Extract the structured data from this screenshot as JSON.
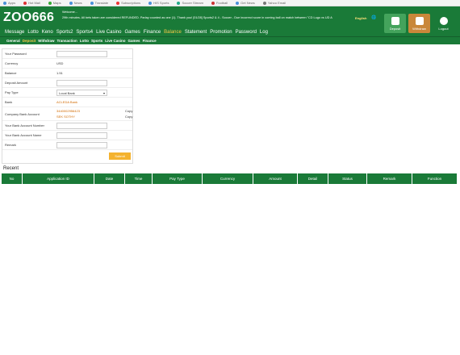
{
  "bookmarks": [
    "Apps",
    "Hot Mail",
    "Maps",
    "News",
    "Translate",
    "Subscriptions",
    "HIS Sports",
    "Soccer Stream",
    "Football",
    "Get News",
    "Yahoo Email"
  ],
  "header": {
    "logo": "ZOO666",
    "announcement_line1": "Welcome...",
    "announcement_line2": "29th minutes. All bets taken are considered REFUNDED. Parlay counted as one (1). Thank you!   [01/28] Sports2 & 4 - Soccer - Due incorrect score in coming ball on match between \"CD Lugo vs UD A",
    "language": "English",
    "language_icon": "globe-icon",
    "deposit_label": "Deposit",
    "withdraw_label": "Withdraw",
    "logout_label": "Logout"
  },
  "main_nav": [
    "Message",
    "Lotto",
    "Keno",
    "Sports2",
    "Sports4",
    "Live Casino",
    "Games",
    "Finance",
    "Balance",
    "Statement",
    "Promotion",
    "Password",
    "Log"
  ],
  "main_nav_active": "Balance",
  "sub_nav": [
    "General",
    "Deposit",
    "Withdraw",
    "Transaction",
    "Lotto",
    "Sports",
    "Live Casino",
    "Games",
    "Finance"
  ],
  "sub_nav_active": "Deposit",
  "form": {
    "your_password_label": "Your Password",
    "currency_label": "Currency",
    "currency_value": "USD",
    "balance_label": "Balance",
    "balance_value": "1.51",
    "deposit_amount_label": "Deposit Amount",
    "pay_type_label": "Pay Type",
    "pay_type_value": "Local Bank",
    "bank_label": "Bank",
    "bank_value": "ACLEDA Bank",
    "company_bank_account_label": "Company Bank Account",
    "company_bank_account_number": "3440002956423",
    "company_bank_account_name": "SEK SOTHY",
    "copy_label": "Copy",
    "your_bank_account_number_label": "Your Bank Account Number",
    "your_bank_account_name_label": "Your Bank Account Name",
    "remark_label": "Remark",
    "submit_label": "Submit"
  },
  "recent": {
    "title": "Recent",
    "columns": [
      "No",
      "Application ID",
      "Date",
      "Time",
      "Pay Type",
      "Currency",
      "Amount",
      "Detail",
      "Status",
      "Remark",
      "Function"
    ]
  }
}
